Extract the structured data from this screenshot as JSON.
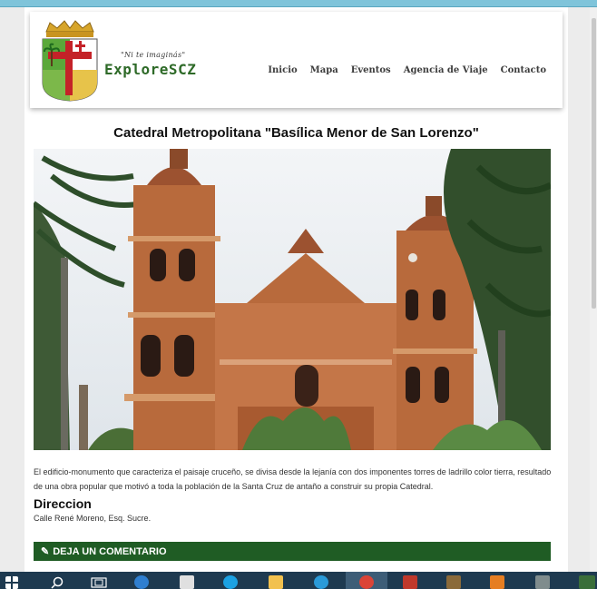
{
  "header": {
    "tagline": "\"Ni te imaginás\"",
    "brand": "ExploreSCZ",
    "nav": [
      "Inicio",
      "Mapa",
      "Eventos",
      "Agencia de Viaje",
      "Contacto"
    ]
  },
  "article": {
    "title": "Catedral Metropolitana \"Basílica Menor de San Lorenzo\"",
    "description": "El edificio-monumento que caracteriza el paisaje cruceño, se divisa desde la lejanía con dos imponentes torres de ladrillo color tierra, resultado de una obra popular que motivó a toda la población de la Santa Cruz de antaño a construir su propia Catedral.",
    "direccion_label": "Direccion",
    "direccion_value": "Calle René Moreno, Esq. Sucre.",
    "comment_label": "DEJA UN COMENTARIO"
  },
  "colors": {
    "accent_green": "#1f5c24",
    "brand_green": "#2e6a28",
    "taskbar": "#1e3a50"
  },
  "taskbar": {
    "icons": [
      "windows-icon",
      "search-icon",
      "task-view-icon",
      "edge-icon",
      "store-icon",
      "skype-icon",
      "explorer-icon",
      "ie-icon",
      "chrome-icon",
      "app-icon",
      "pencil-app-icon",
      "photos-icon",
      "sublime-icon",
      "dreamweaver-icon"
    ]
  }
}
